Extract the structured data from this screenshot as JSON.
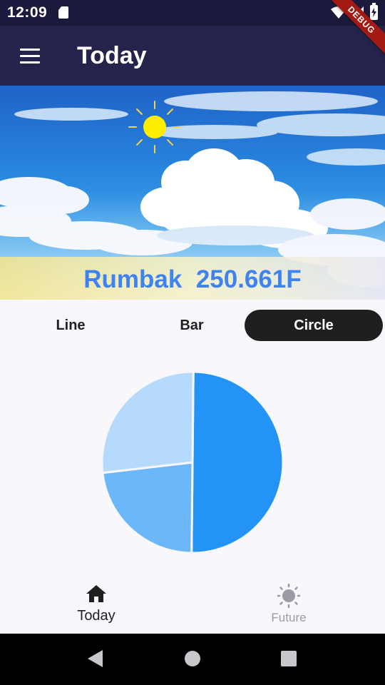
{
  "status_bar": {
    "time": "12:09",
    "icons": [
      "sd-card-icon",
      "wifi-icon",
      "signal-icon",
      "battery-icon"
    ]
  },
  "debug_banner": "DEBUG",
  "app_bar": {
    "title": "Today",
    "menu_icon": "hamburger-menu-icon"
  },
  "hero": {
    "caption": "Rumbak  250.661F",
    "sun_icon": "sun-icon"
  },
  "chart_toggle": {
    "options": [
      "Line",
      "Bar",
      "Circle"
    ],
    "selected": "Circle"
  },
  "chart_data": {
    "type": "pie",
    "values": [
      50,
      23,
      27
    ],
    "colors": [
      "#2394f5",
      "#6cb6fa",
      "#b6dafc"
    ]
  },
  "bottom_nav": {
    "items": [
      {
        "label": "Today",
        "icon": "home-icon",
        "active": true
      },
      {
        "label": "Future",
        "icon": "sun-outline-icon",
        "active": false
      }
    ]
  },
  "system_nav": {
    "icons": [
      "back-icon",
      "home-circle-icon",
      "recents-icon"
    ]
  },
  "colors": {
    "app_bar": "#25234b",
    "status_bar": "#1b1a3c",
    "caption": "#3f83f0",
    "selected_toggle": "#1f1f1f",
    "background": "#f8f8fc"
  }
}
